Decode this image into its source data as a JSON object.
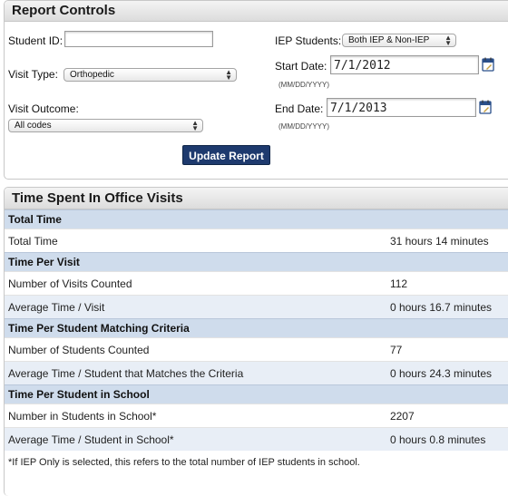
{
  "report_controls": {
    "title": "Report Controls",
    "student_id": {
      "label": "Student ID:",
      "value": ""
    },
    "visit_type": {
      "label": "Visit Type:",
      "selected": "Orthopedic"
    },
    "visit_outcome": {
      "label": "Visit Outcome:",
      "selected": "All codes"
    },
    "iep_students": {
      "label": "IEP Students:",
      "selected": "Both IEP & Non-IEP"
    },
    "start_date": {
      "label": "Start Date:",
      "value": "7/1/2012",
      "hint": "(MM/DD/YYYY)"
    },
    "end_date": {
      "label": "End Date:",
      "value": "7/1/2013",
      "hint": "(MM/DD/YYYY)"
    },
    "update_button": "Update Report"
  },
  "time_spent": {
    "title": "Time Spent In Office Visits",
    "sections": [
      {
        "heading": "Total Time",
        "rows": [
          {
            "label": "Total Time",
            "value": "31 hours 14 minutes"
          }
        ]
      },
      {
        "heading": "Time Per Visit",
        "rows": [
          {
            "label": "Number of Visits Counted",
            "value": "112"
          },
          {
            "label": "Average Time / Visit",
            "value": "0 hours 16.7 minutes"
          }
        ]
      },
      {
        "heading": "Time Per Student Matching Criteria",
        "rows": [
          {
            "label": "Number of Students Counted",
            "value": "77"
          },
          {
            "label": "Average Time / Student that Matches the Criteria",
            "value": "0 hours 24.3 minutes"
          }
        ]
      },
      {
        "heading": "Time Per Student in School",
        "rows": [
          {
            "label": "Number in Students in School*",
            "value": "2207"
          },
          {
            "label": "Average Time / Student in School*",
            "value": "0 hours 0.8 minutes"
          }
        ]
      }
    ],
    "footnote": "*If IEP Only is selected, this refers to the total number of IEP students in school."
  },
  "colors": {
    "button_bg": "#1e3a6e",
    "section_bg": "#cfdcec",
    "alt_row_bg": "#e8eef6"
  },
  "icons": [
    "calendar-icon",
    "select-arrows-icon"
  ]
}
